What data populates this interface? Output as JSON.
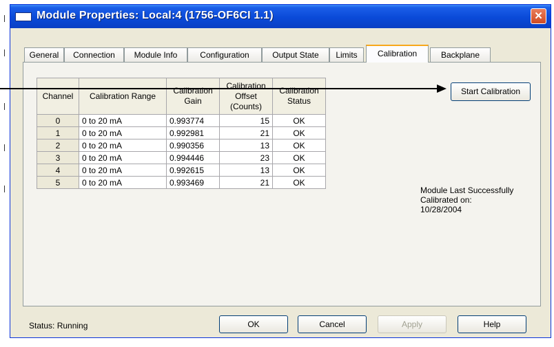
{
  "window": {
    "title": "Module Properties: Local:4 (1756-OF6CI 1.1)",
    "close_label": "✕"
  },
  "tabs": [
    {
      "label": "General",
      "active": false
    },
    {
      "label": "Connection",
      "active": false
    },
    {
      "label": "Module Info",
      "active": false
    },
    {
      "label": "Configuration",
      "active": false
    },
    {
      "label": "Output State",
      "active": false
    },
    {
      "label": "Limits",
      "active": false
    },
    {
      "label": "Calibration",
      "active": true
    },
    {
      "label": "Backplane",
      "active": false
    }
  ],
  "calibration_table": {
    "headers": [
      "Channel",
      "Calibration Range",
      "Calibration Gain",
      "Calibration Offset (Counts)",
      "Calibration Status"
    ],
    "rows": [
      {
        "channel": "0",
        "range": "0 to 20 mA",
        "gain": "0.993774",
        "offset": "15",
        "status": "OK"
      },
      {
        "channel": "1",
        "range": "0 to 20 mA",
        "gain": "0.992981",
        "offset": "21",
        "status": "OK"
      },
      {
        "channel": "2",
        "range": "0 to 20 mA",
        "gain": "0.990356",
        "offset": "13",
        "status": "OK"
      },
      {
        "channel": "3",
        "range": "0 to 20 mA",
        "gain": "0.994446",
        "offset": "23",
        "status": "OK"
      },
      {
        "channel": "4",
        "range": "0 to 20 mA",
        "gain": "0.992615",
        "offset": "13",
        "status": "OK"
      },
      {
        "channel": "5",
        "range": "0 to 20 mA",
        "gain": "0.993469",
        "offset": "21",
        "status": "OK"
      }
    ]
  },
  "start_calibration_label": "Start Calibration",
  "last_calibrated": {
    "line1": "Module Last Successfully",
    "line2": "Calibrated on:",
    "date": "10/28/2004"
  },
  "status": {
    "label": "Status:",
    "value": "Running"
  },
  "buttons": {
    "ok": "OK",
    "cancel": "Cancel",
    "apply": "Apply",
    "help": "Help"
  },
  "colors": {
    "titlebar": "#0a4ad8",
    "window_bg": "#ece9d8",
    "active_tab_accent": "#f7a71a",
    "close_button": "#d04b23"
  }
}
